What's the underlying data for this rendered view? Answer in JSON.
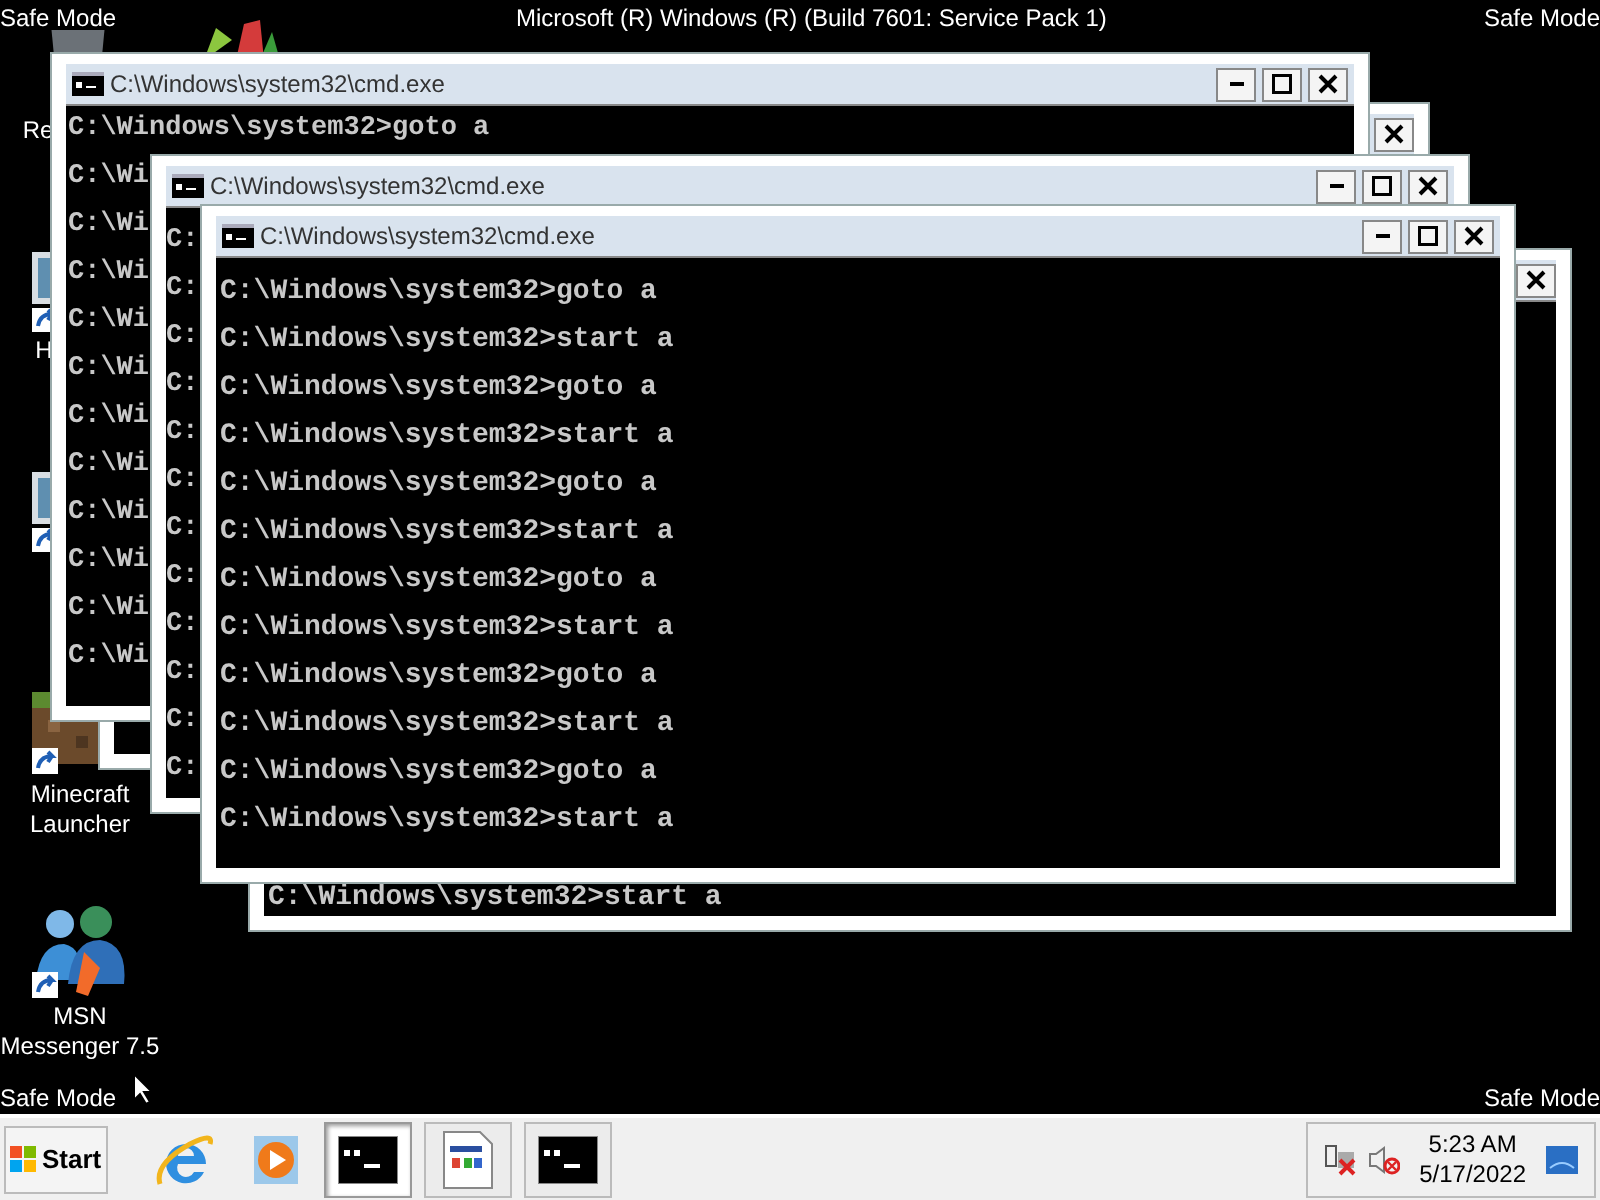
{
  "desktop": {
    "top_left": "Safe Mode",
    "build": "Microsoft (R) Windows (R) (Build 7601: Service Pack 1)",
    "top_right": "Safe Mode",
    "bottom_left": "Safe Mode",
    "bottom_right": "Safe Mode"
  },
  "desktop_icons": [
    {
      "label": "Re"
    },
    {
      "label": "H"
    },
    {
      "label": "Minecraft Launcher"
    },
    {
      "label": "MSN Messenger 7.5"
    }
  ],
  "windows": [
    {
      "buttons": [
        {
          "kind": "close"
        }
      ]
    },
    {
      "title": "C:\\Windows\\system32\\cmd.exe",
      "buttons": [
        {
          "kind": "minimize"
        },
        {
          "kind": "maximize"
        },
        {
          "kind": "close"
        }
      ],
      "lines": [
        "C:\\Windows\\system32>goto a",
        "C:\\Wi",
        "C:\\Wi",
        "C:\\Wi",
        "C:\\Wi",
        "C:\\Wi",
        "C:\\Wi",
        "C:\\Wi",
        "C:\\Wi",
        "C:\\Wi",
        "C:\\Wi",
        "C:\\Wi"
      ]
    },
    {
      "title": "C:\\Windows\\system32\\cmd.exe",
      "buttons": [
        {
          "kind": "minimize"
        },
        {
          "kind": "maximize"
        },
        {
          "kind": "close"
        }
      ],
      "lines": [
        "C:",
        "C:",
        "C:",
        "C:",
        "C:",
        "C:",
        "C:",
        "C:",
        "C:",
        "C:",
        "C:",
        "C:"
      ]
    },
    {
      "title": "C:\\Windows\\system32\\cmd.exe",
      "buttons": [
        {
          "kind": "minimize"
        },
        {
          "kind": "maximize"
        },
        {
          "kind": "close"
        }
      ],
      "lines": [
        "C:\\Windows\\system32>goto a",
        "C:\\Windows\\system32>start a",
        "C:\\Windows\\system32>goto a",
        "C:\\Windows\\system32>start a",
        "C:\\Windows\\system32>goto a",
        "C:\\Windows\\system32>start a",
        "C:\\Windows\\system32>goto a",
        "C:\\Windows\\system32>start a",
        "C:\\Windows\\system32>goto a",
        "C:\\Windows\\system32>start a",
        "C:\\Windows\\system32>goto a",
        "C:\\Windows\\system32>start a"
      ]
    },
    {
      "buttons": [
        {
          "kind": "close"
        }
      ],
      "lines": [
        "C:\\Windows\\system32>start a"
      ]
    }
  ],
  "taskbar": {
    "start": "Start",
    "items": [
      {
        "kind": "ie",
        "selected": false
      },
      {
        "kind": "media",
        "selected": false
      },
      {
        "kind": "console",
        "selected": true
      },
      {
        "kind": "app",
        "selected": false
      },
      {
        "kind": "console",
        "selected": false
      }
    ],
    "time": "5:23 AM",
    "date": "5/17/2022"
  }
}
